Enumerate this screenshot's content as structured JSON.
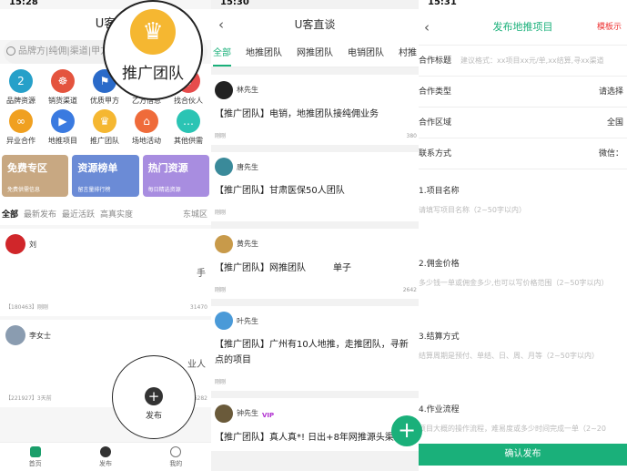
{
  "p1": {
    "status_time": "15:28",
    "title": "U客",
    "search_placeholder": "品牌方|纯佣|渠道|甲方|广",
    "grid": [
      {
        "label": "品牌资源",
        "color": "#26a0c9",
        "glyph": "2"
      },
      {
        "label": "销货渠道",
        "color": "#e4543e",
        "glyph": "☸"
      },
      {
        "label": "优质甲方",
        "color": "#2a6ac9",
        "glyph": "⚑"
      },
      {
        "label": "乙方信息",
        "color": "#2bb673",
        "glyph": "☺"
      },
      {
        "label": "找合伙人",
        "color": "#e64c4c",
        "glyph": "$"
      },
      {
        "label": "异业合作",
        "color": "#f0a020",
        "glyph": "∞"
      },
      {
        "label": "地推项目",
        "color": "#3a7ae0",
        "glyph": "▶"
      },
      {
        "label": "推广团队",
        "color": "#f5b731",
        "glyph": "♛"
      },
      {
        "label": "场地活动",
        "color": "#ef6b3a",
        "glyph": "⌂"
      },
      {
        "label": "其他供需",
        "color": "#2bc4b4",
        "glyph": "…"
      }
    ],
    "banners": [
      {
        "title": "免费专区",
        "sub": "免费供需信息",
        "color": "#c8a882"
      },
      {
        "title": "资源榜单",
        "sub": "留言量排行榜",
        "color": "#6b8bd6"
      },
      {
        "title": "热门资源",
        "sub": "每日精选资源",
        "color": "#a88de0"
      }
    ],
    "feed_tabs": [
      "全部",
      "最新发布",
      "最近活跃",
      "高真实度"
    ],
    "feed_region": "东城区",
    "cards": [
      {
        "name": "刘",
        "text": "手",
        "id": "【180463】刚刚",
        "views": "31470",
        "avatar": "#d0262a"
      },
      {
        "name": "李女士",
        "text": "业人",
        "id": "【221927】3天前",
        "views": "6282",
        "avatar": "#8a9cb0"
      }
    ],
    "big_label": "推广团队",
    "pub_label": "发布",
    "tabbar": [
      "首页",
      "发布",
      "我的"
    ]
  },
  "p2": {
    "status_time": "15:30",
    "title": "U客直谈",
    "tabs": [
      "全部",
      "地推团队",
      "网推团队",
      "电销团队",
      "村推"
    ],
    "posts": [
      {
        "name": "林先生",
        "text": "【推广团队】电销，地推团队接纯佣业务",
        "meta": "刚刚",
        "views": "380",
        "avatar": "#222",
        "vip": ""
      },
      {
        "name": "唐先生",
        "text": "【推广团队】甘肃医保50人团队",
        "meta": "刚刚",
        "views": "",
        "avatar": "#3a8a9a",
        "vip": ""
      },
      {
        "name": "黄先生",
        "text": "【推广团队】网推团队　　　单子",
        "meta": "刚刚",
        "views": "2642",
        "avatar": "#c89a4a",
        "vip": ""
      },
      {
        "name": "叶先生",
        "text": "【推广团队】广州有10人地推，走推团队，寻新点的项目",
        "meta": "刚刚",
        "views": "",
        "avatar": "#4a9ad8",
        "vip": ""
      },
      {
        "name": "钟先生",
        "text": "【推广团队】真人真*! 日出+8年网推源头渠道",
        "meta": "",
        "views": "",
        "avatar": "#6a5a3a",
        "vip": "VIP"
      }
    ],
    "fab": "+"
  },
  "p3": {
    "status_time": "15:31",
    "title": "发布地推项目",
    "template": "模板示",
    "rows": [
      {
        "k": "合作标题",
        "ph": "建议格式：xx项目xx元/单,xx结算,寻xx渠道",
        "v": ""
      },
      {
        "k": "合作类型",
        "ph": "",
        "v": "请选择"
      },
      {
        "k": "合作区域",
        "ph": "",
        "v": "全国"
      },
      {
        "k": "联系方式",
        "ph": "",
        "v": "微信："
      }
    ],
    "sections": [
      {
        "t": "1.项目名称",
        "ph": "请填写项目名称（2~50字以内）"
      },
      {
        "t": "2.佣金价格",
        "ph": "多少钱一单或佣金多少,也可以写价格范围（2~50字以内）"
      },
      {
        "t": "3.结算方式",
        "ph": "结算周期是预付、单结、日、周、月等（2~50字以内）"
      },
      {
        "t": "4.作业流程",
        "ph": "项目大概的操作流程，难易度或多少时间完成一单（2~20"
      }
    ],
    "submit": "确认发布"
  }
}
